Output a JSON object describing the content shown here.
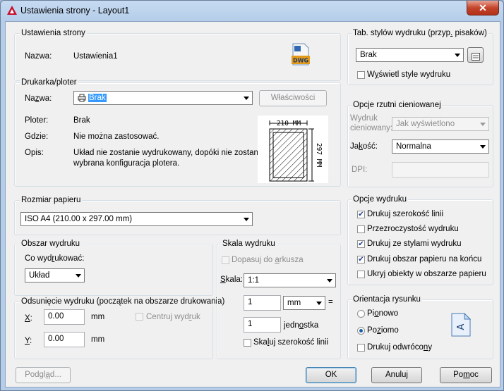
{
  "window": {
    "title": "Ustawienia strony - Layout1",
    "close_label": "✕"
  },
  "page_setup": {
    "group_title": "Ustawienia strony",
    "name_label": "Nazwa:",
    "name_value": "Ustawienia1",
    "dwg_icon_text": "DWG"
  },
  "printer": {
    "group_title": "Drukarka/ploter",
    "name_label": "Nazwa:",
    "name_value": "Brak",
    "properties_button": "Właściwości",
    "plotter_label": "Ploter:",
    "plotter_value": "Brak",
    "where_label": "Gdzie:",
    "where_value": "Nie można zastosować.",
    "desc_label": "Opis:",
    "desc_value_line1": "Układ nie zostanie wydrukowany, dopóki nie zostanie",
    "desc_value_line2": "wybrana konfiguracja plotera.",
    "preview_width": "210 MM",
    "preview_height": "297 MM"
  },
  "paper_size": {
    "group_title": "Rozmiar papieru",
    "value": "ISO A4 (210.00 x 297.00 mm)"
  },
  "plot_area": {
    "group_title": "Obszar wydruku",
    "what_label": "Co wydrukować:",
    "what_value": "Układ"
  },
  "plot_offset": {
    "group_title": "Odsunięcie wydruku (początek na obszarze drukowania)",
    "x_label": "X:",
    "x_value": "0.00",
    "x_unit": "mm",
    "y_label": "Y:",
    "y_value": "0.00",
    "y_unit": "mm",
    "center_label": "Centruj wydruk"
  },
  "plot_scale": {
    "group_title": "Skala wydruku",
    "fit_label": "Dopasuj do arkusza",
    "scale_label": "Skala:",
    "scale_value": "1:1",
    "value1": "1",
    "unit_value": "mm",
    "equals": "=",
    "value2": "1",
    "unit2_label": "jednostka",
    "scale_lineweights_label": "Skaluj szerokość linii"
  },
  "plot_style_table": {
    "group_title": "Tab. stylów wydruku (przyp. pisaków)",
    "value": "Brak",
    "display_label": "Wyświetl style wydruku"
  },
  "shaded_viewport": {
    "group_title": "Opcje rzutni cieniowanej",
    "shade_label_line1": "Wydruk",
    "shade_label_line2": "cieniowany:",
    "shade_value": "Jak wyświetlono",
    "quality_label": "Jakość:",
    "quality_value": "Normalna",
    "dpi_label": "DPI:"
  },
  "plot_options": {
    "group_title": "Opcje wydruku",
    "items": [
      {
        "label": "Drukuj szerokość linii",
        "checked": true
      },
      {
        "label": "Przezroczystość wydruku",
        "checked": false
      },
      {
        "label": "Drukuj ze stylami wydruku",
        "checked": true
      },
      {
        "label": "Drukuj obszar papieru na końcu",
        "checked": true
      },
      {
        "label": "Ukryj obiekty w obszarze papieru",
        "checked": false
      }
    ]
  },
  "orientation": {
    "group_title": "Orientacja rysunku",
    "portrait_label": "Pionowo",
    "landscape_label": "Poziomo",
    "upside_down_label": "Drukuj odwrócony",
    "icon_letter": "A"
  },
  "buttons": {
    "preview": "Podgląd...",
    "ok": "OK",
    "cancel": "Anuluj",
    "help": "Pomoc"
  }
}
